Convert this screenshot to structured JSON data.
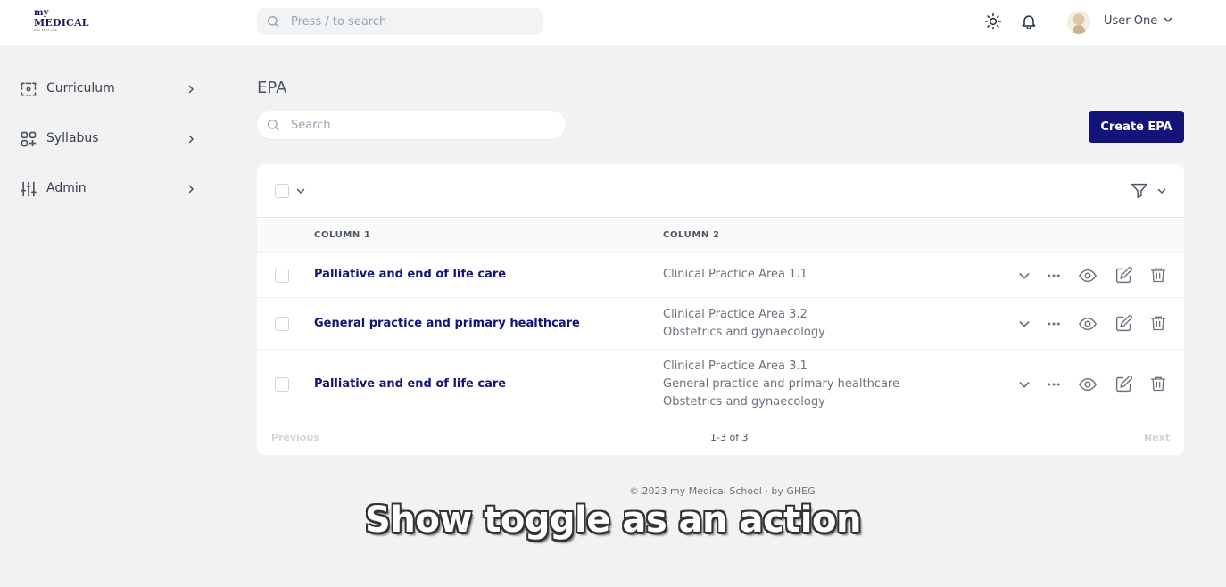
{
  "header": {
    "logo": {
      "line1": "my",
      "line2": "MEDICAL",
      "line3": "SCHOOL"
    },
    "search_placeholder": "Press / to search",
    "theme_icon": "sun-icon",
    "notifications_icon": "bell-icon",
    "user_name": "User One"
  },
  "sidebar": {
    "items": [
      {
        "label": "Curriculum",
        "icon": "curriculum-icon"
      },
      {
        "label": "Syllabus",
        "icon": "syllabus-icon"
      },
      {
        "label": "Admin",
        "icon": "admin-sliders-icon"
      }
    ]
  },
  "main": {
    "title": "EPA",
    "search_placeholder": "Search",
    "create_button": "Create EPA",
    "columns": [
      "COLUMN 1",
      "COLUMN 2"
    ],
    "rows": [
      {
        "col1": "Palliative and end of life care",
        "col2": [
          "Clinical Practice Area 1.1"
        ]
      },
      {
        "col1": "General practice and primary healthcare",
        "col2": [
          "Clinical Practice Area 3.2",
          "Obstetrics and gynaecology"
        ]
      },
      {
        "col1": "Palliative and end of life care",
        "col2": [
          "Clinical Practice Area 3.1",
          "General practice and primary healthcare",
          "Obstetrics and gynaecology"
        ]
      }
    ],
    "pagination": {
      "previous": "Previous",
      "info": "1-3 of 3",
      "next": "Next"
    }
  },
  "footer": "© 2023 my Medical School · by GHEG",
  "caption": "Show toggle as an action",
  "colors": {
    "primary": "#13137a",
    "background": "#f2f2f3"
  }
}
